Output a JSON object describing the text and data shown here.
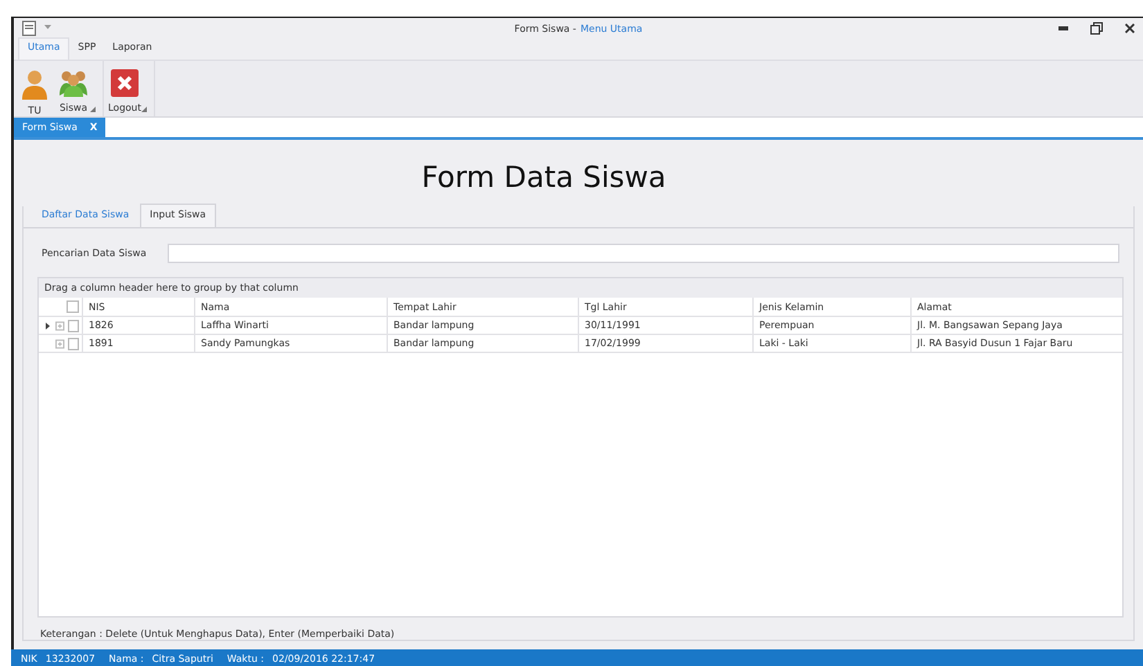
{
  "window": {
    "title": "Form Siswa -",
    "title_app": "Menu Utama"
  },
  "ribbon": {
    "tabs": [
      {
        "label": "Utama",
        "selected": true
      },
      {
        "label": "SPP",
        "selected": false
      },
      {
        "label": "Laporan",
        "selected": false
      }
    ],
    "groups": [
      {
        "buttons": [
          {
            "label": "TU",
            "kind": "user"
          },
          {
            "label": "Siswa",
            "kind": "users"
          }
        ]
      },
      {
        "buttons": [
          {
            "label": "Logout",
            "kind": "logout"
          }
        ]
      }
    ]
  },
  "document_tabs": [
    {
      "label": "Form Siswa",
      "close": "X",
      "selected": true
    }
  ],
  "form": {
    "heading": "Form Data Siswa",
    "tabs": [
      {
        "label": "Daftar Data Siswa",
        "selected": true
      },
      {
        "label": "Input Siswa",
        "selected": false
      }
    ],
    "search_label": "Pencarian Data Siswa",
    "grid": {
      "group_panel": "Drag a column header here to group by that column",
      "header_checked": false,
      "columns": [
        "NIS",
        "Nama",
        "Tempat Lahir",
        "Tgl Lahir",
        "Jenis Kelamin",
        "Alamat"
      ],
      "rows": [
        {
          "focused": true,
          "checked": false,
          "cells": [
            "1826",
            "Laffha Winarti",
            "Bandar lampung",
            "30/11/1991",
            "Perempuan",
            "Jl. M. Bangsawan Sepang Jaya"
          ]
        },
        {
          "focused": false,
          "checked": false,
          "cells": [
            "1891",
            "Sandy Pamungkas",
            "Bandar lampung",
            "17/02/1999",
            "Laki - Laki",
            "Jl. RA Basyid Dusun 1 Fajar Baru"
          ]
        }
      ]
    },
    "note": "Keterangan : Delete (Untuk Menghapus Data), Enter (Memperbaiki Data)"
  },
  "status_bar": [
    {
      "label": "NIK",
      "value": "13232007"
    },
    {
      "label": "Nama :",
      "value": "Citra Saputri"
    },
    {
      "label": "Waktu :",
      "value": "02/09/2016 22:17:47"
    }
  ]
}
